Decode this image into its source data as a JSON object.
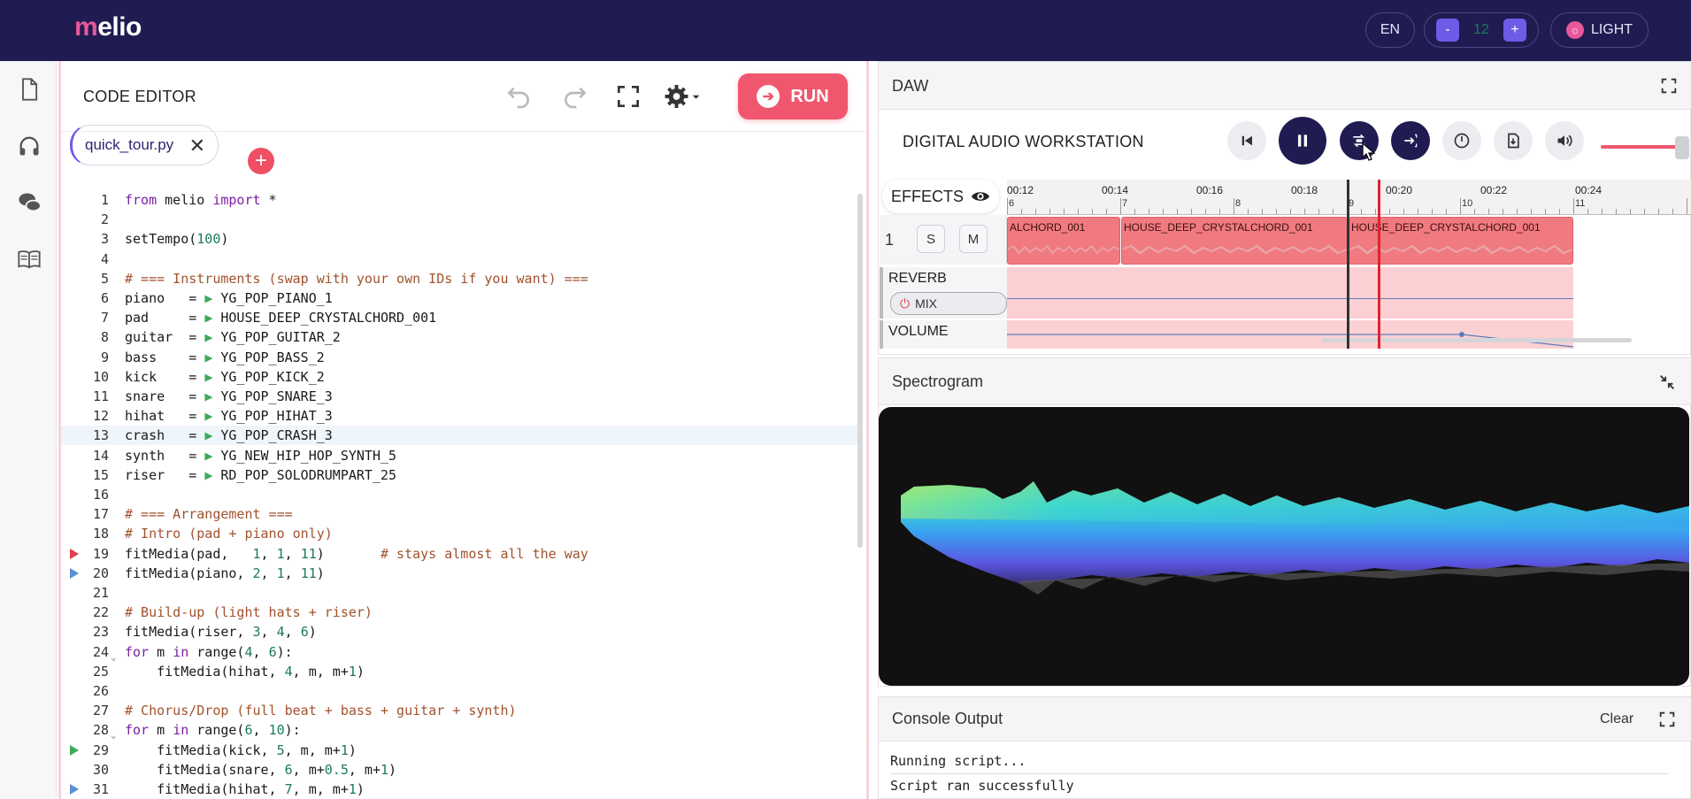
{
  "header": {
    "logo_prefix": "m",
    "logo_rest": "elio",
    "language": "EN",
    "font_decrease": "-",
    "font_size": "12",
    "font_increase": "+",
    "theme": "LIGHT"
  },
  "editor": {
    "title": "CODE EDITOR",
    "run_label": "RUN",
    "tab_name": "quick_tour.py",
    "lines": [
      {
        "n": "1",
        "code": "from melio import *"
      },
      {
        "n": "2",
        "code": ""
      },
      {
        "n": "3",
        "code": "setTempo(100)"
      },
      {
        "n": "4",
        "code": ""
      },
      {
        "n": "5",
        "code": "# === Instruments (swap with your own IDs if you want) ==="
      },
      {
        "n": "6",
        "code": "piano   = ▶ YG_POP_PIANO_1"
      },
      {
        "n": "7",
        "code": "pad     = ▶ HOUSE_DEEP_CRYSTALCHORD_001"
      },
      {
        "n": "8",
        "code": "guitar  = ▶ YG_POP_GUITAR_2"
      },
      {
        "n": "9",
        "code": "bass    = ▶ YG_POP_BASS_2"
      },
      {
        "n": "10",
        "code": "kick    = ▶ YG_POP_KICK_2"
      },
      {
        "n": "11",
        "code": "snare   = ▶ YG_POP_SNARE_3"
      },
      {
        "n": "12",
        "code": "hihat   = ▶ YG_POP_HIHAT_3"
      },
      {
        "n": "13",
        "code": "crash   = ▶ YG_POP_CRASH_3"
      },
      {
        "n": "14",
        "code": "synth   = ▶ YG_NEW_HIP_HOP_SYNTH_5"
      },
      {
        "n": "15",
        "code": "riser   = ▶ RD_POP_SOLODRUMPART_25"
      },
      {
        "n": "16",
        "code": ""
      },
      {
        "n": "17",
        "code": "# === Arrangement ==="
      },
      {
        "n": "18",
        "code": "# Intro (pad + piano only)"
      },
      {
        "n": "19",
        "code": "fitMedia(pad,   1, 1, 11)       # stays almost all the way"
      },
      {
        "n": "20",
        "code": "fitMedia(piano, 2, 1, 11)"
      },
      {
        "n": "21",
        "code": ""
      },
      {
        "n": "22",
        "code": "# Build-up (light hats + riser)"
      },
      {
        "n": "23",
        "code": "fitMedia(riser, 3, 4, 6)"
      },
      {
        "n": "24",
        "code": "for m in range(4, 6):"
      },
      {
        "n": "25",
        "code": "    fitMedia(hihat, 4, m, m+1)"
      },
      {
        "n": "26",
        "code": ""
      },
      {
        "n": "27",
        "code": "# Chorus/Drop (full beat + bass + guitar + synth)"
      },
      {
        "n": "28",
        "code": "for m in range(6, 10):"
      },
      {
        "n": "29",
        "code": "    fitMedia(kick, 5, m, m+1)"
      },
      {
        "n": "30",
        "code": "    fitMedia(snare, 6, m+0.5, m+1)"
      },
      {
        "n": "31",
        "code": "    fitMedia(hihat, 7, m, m+1)"
      }
    ]
  },
  "daw": {
    "title": "DAW",
    "subtitle": "DIGITAL AUDIO WORKSTATION",
    "effects_label": "EFFECTS",
    "time_labels": [
      "00:12",
      "00:14",
      "00:16",
      "00:18",
      "00:20",
      "00:22",
      "00:24"
    ],
    "measure_labels": [
      "6",
      "7",
      "8",
      "9",
      "10",
      "11"
    ],
    "track": {
      "number": "1",
      "solo": "S",
      "mute": "M",
      "clips": [
        "ALCHORD_001",
        "HOUSE_DEEP_CRYSTALCHORD_001",
        "HOUSE_DEEP_CRYSTALCHORD_001"
      ]
    },
    "effects": [
      {
        "name": "REVERB",
        "param": "MIX"
      },
      {
        "name": "VOLUME",
        "param": ""
      }
    ],
    "volume_level": 0.88
  },
  "spectrogram": {
    "title": "Spectrogram"
  },
  "console": {
    "title": "Console Output",
    "clear_label": "Clear",
    "lines": [
      "Running script...",
      "Script ran successfully"
    ]
  },
  "colors": {
    "topbar": "#201c52",
    "accent": "#f0576e",
    "purple": "#6c5ce7",
    "clip": "#f07a80"
  }
}
